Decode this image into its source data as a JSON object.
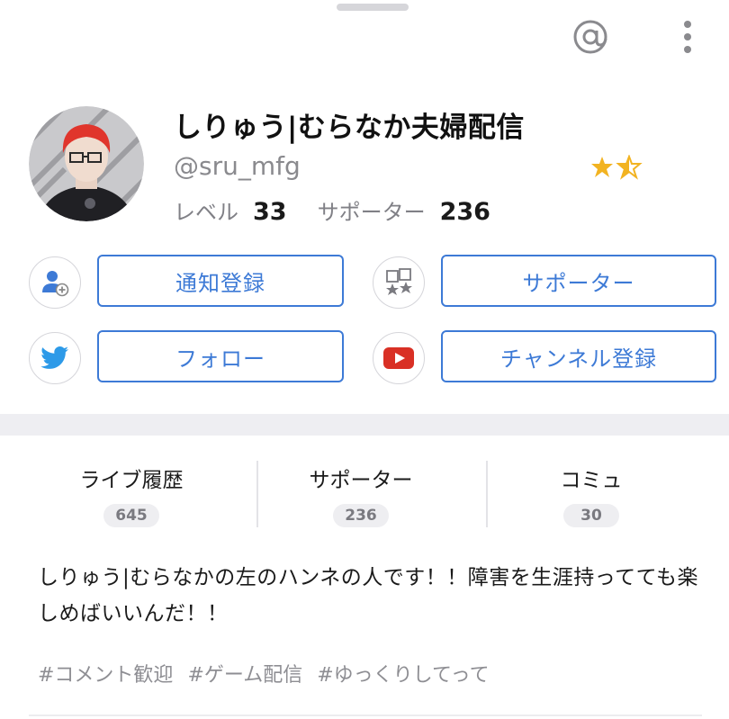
{
  "header": {
    "mention_icon": "at-sign-icon",
    "menu_icon": "vertical-more-icon"
  },
  "profile": {
    "name": "しりゅう|むらなか夫婦配信",
    "handle": "@sru_mfg",
    "rating_stars": 1.5,
    "star_color": "#f2b321",
    "level_label": "レベル",
    "level_value": "33",
    "supporter_label": "サポーター",
    "supporter_value": "236"
  },
  "actions": {
    "notify_label": "通知登録",
    "supporter_label": "サポーター",
    "follow_label": "フォロー",
    "channel_label": "チャンネル登録",
    "accent_color": "#3d7ad6",
    "twitter_color": "#2d9ae8",
    "youtube_color": "#d93025"
  },
  "tabs": [
    {
      "label": "ライブ履歴",
      "count": "645"
    },
    {
      "label": "サポーター",
      "count": "236"
    },
    {
      "label": "コミュ",
      "count": "30"
    }
  ],
  "bio": {
    "text": "しりゅう|むらなかの左のハンネの人です！！障害を生涯持ってても楽しめばいいんだ！！"
  },
  "tags": [
    "#コメント歓迎",
    "#ゲーム配信",
    "#ゆっくりしてって"
  ]
}
